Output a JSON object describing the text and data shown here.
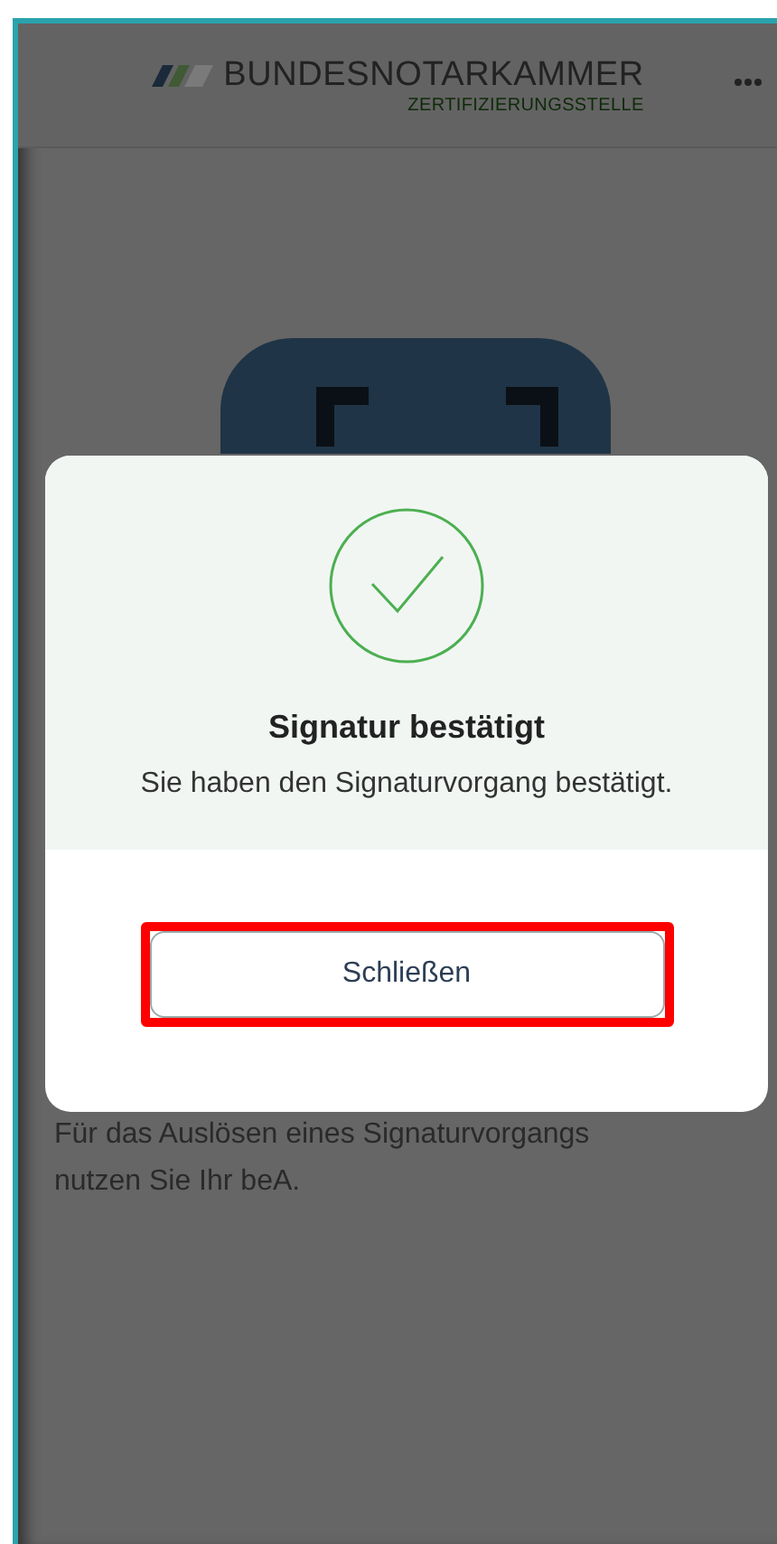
{
  "header": {
    "brand": "BUNDESNOTARKAMMER",
    "subtitle": "ZERTIFIZIERUNGSSTELLE"
  },
  "background_text": "Für das Auslösen eines Signaturvorgangs nutzen Sie Ihr beA.",
  "dialog": {
    "title": "Signatur bestätigt",
    "message": "Sie haben den Signaturvorgang bestätigt.",
    "button": {
      "label": "Schließen",
      "highlighted": true
    }
  }
}
